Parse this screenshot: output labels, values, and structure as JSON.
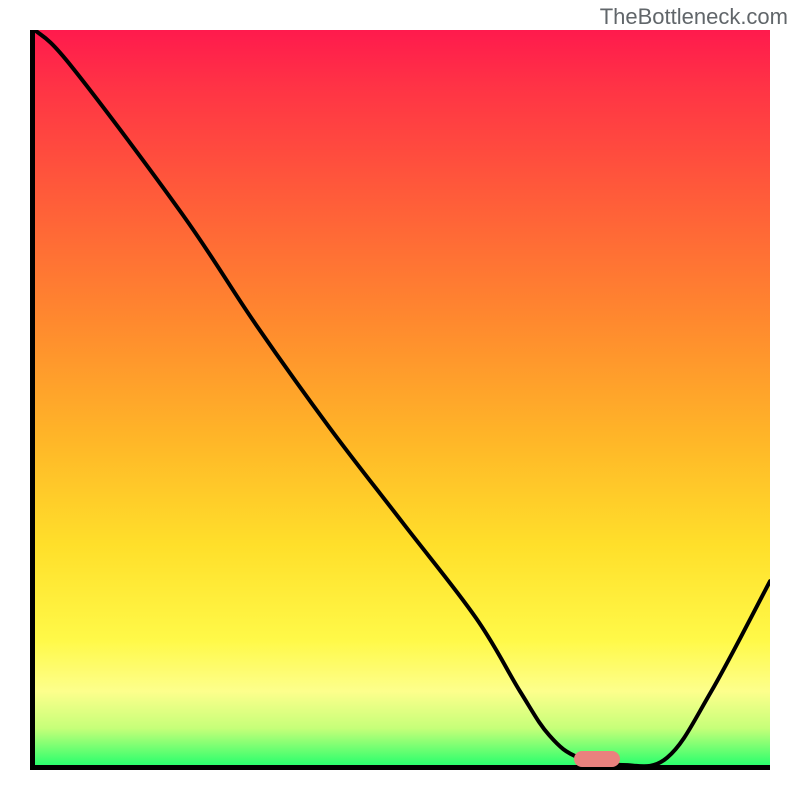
{
  "watermark": "TheBottleneck.com",
  "chart_data": {
    "type": "line",
    "title": "",
    "xlabel": "",
    "ylabel": "",
    "xlim": [
      0,
      100
    ],
    "ylim": [
      0,
      100
    ],
    "x": [
      0,
      5,
      20,
      30,
      40,
      50,
      60,
      66,
      70,
      74,
      80,
      86,
      92,
      100
    ],
    "values": [
      100,
      95,
      75,
      60,
      46,
      33,
      20,
      10,
      4,
      1,
      0,
      1,
      10,
      25
    ],
    "optimum_marker_x": 76,
    "background": "vertical red→green gradient"
  }
}
